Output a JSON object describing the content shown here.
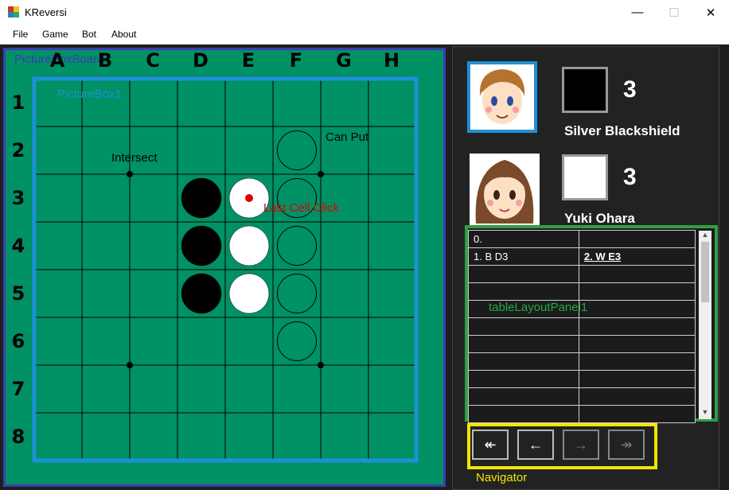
{
  "window": {
    "title": "KReversi",
    "minimize": "—",
    "maximize": "☐",
    "close": "✕"
  },
  "menu": [
    "File",
    "Game",
    "Bot",
    "About"
  ],
  "board": {
    "columns": [
      "A",
      "B",
      "C",
      "D",
      "E",
      "F",
      "G",
      "H"
    ],
    "rows": [
      "1",
      "2",
      "3",
      "4",
      "5",
      "6",
      "7",
      "8"
    ],
    "label_board": "PictureBoxBoard",
    "label_box1": "PictureBox1",
    "label_intersect": "Intersect",
    "label_canput": "Can Put",
    "label_lastclick": "Last Cell Click",
    "pieces": [
      {
        "cell": "D3",
        "color": "black"
      },
      {
        "cell": "E3",
        "color": "white",
        "last": true
      },
      {
        "cell": "D4",
        "color": "black"
      },
      {
        "cell": "E4",
        "color": "white"
      },
      {
        "cell": "D5",
        "color": "black"
      },
      {
        "cell": "E5",
        "color": "white"
      }
    ],
    "hints": [
      "F2",
      "F3",
      "F4",
      "F5",
      "F6"
    ],
    "colors": {
      "felt": "#009164",
      "frame": "#3c3cb4",
      "inner": "#1e90d6",
      "last": "#e00000"
    }
  },
  "players": [
    {
      "name": "Silver Blackshield",
      "score": "3",
      "piece": "black",
      "active": true
    },
    {
      "name": "Yuki Ohara",
      "score": "3",
      "piece": "white",
      "active": false
    }
  ],
  "moves": {
    "rows": [
      [
        "0.",
        ""
      ],
      [
        "1. B  D3",
        "2. W  E3"
      ],
      [
        "",
        ""
      ],
      [
        "",
        ""
      ],
      [
        "",
        ""
      ],
      [
        "",
        ""
      ],
      [
        "",
        ""
      ],
      [
        "",
        ""
      ],
      [
        "",
        ""
      ],
      [
        "",
        ""
      ],
      [
        "",
        ""
      ]
    ],
    "label": "tableLayoutPanel1"
  },
  "navigator": {
    "label": "Navigator",
    "buttons": [
      {
        "icon": "first-icon",
        "glyph": "↞",
        "enabled": true
      },
      {
        "icon": "prev-icon",
        "glyph": "←",
        "enabled": true
      },
      {
        "icon": "next-icon",
        "glyph": "→",
        "enabled": false
      },
      {
        "icon": "last-icon",
        "glyph": "↠",
        "enabled": false
      }
    ]
  }
}
